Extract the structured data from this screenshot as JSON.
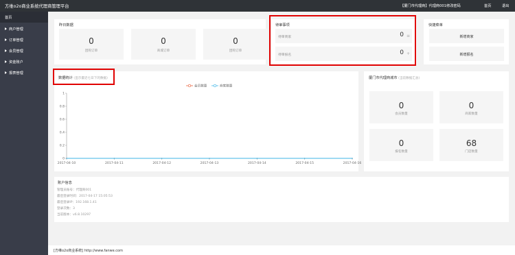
{
  "topbar": {
    "title": "方维o2o商业系统代理商管理平台",
    "user": "【厦门市代理商】代理商001",
    "links": [
      "修改密码",
      "首页",
      "退出"
    ]
  },
  "sidebar": {
    "home": "首页",
    "items": [
      "商户管理",
      "订单管理",
      "会员管理",
      "资金账户",
      "报表管理"
    ]
  },
  "today": {
    "title": "昨日数据",
    "stats": [
      {
        "value": "0",
        "label": "团购订单"
      },
      {
        "value": "0",
        "label": "商城订单"
      },
      {
        "value": "0",
        "label": "团购订单"
      }
    ]
  },
  "todo": {
    "title": "待审事项",
    "rows": [
      {
        "label": "待审商家",
        "value": "0",
        "icon": "≡"
      },
      {
        "label": "待审报名",
        "value": "0",
        "icon": "+"
      }
    ]
  },
  "quick": {
    "title": "快捷菜单",
    "buttons": [
      "新增商家",
      "新增报名"
    ]
  },
  "stats_panel": {
    "title": "数据统计",
    "subtitle": "(显示最近七日下的数据)"
  },
  "chart_data": {
    "type": "line",
    "legend_position": "top-center",
    "x": [
      "2017-04-10",
      "2017-04-11",
      "2017-04-12",
      "2017-04-13",
      "2017-04-14",
      "2017-04-15",
      "2017-04-16"
    ],
    "series": [
      {
        "name": "会员数量",
        "color": "#e8603a",
        "values": [
          0,
          0,
          0,
          0,
          0,
          0,
          0
        ]
      },
      {
        "name": "商家数量",
        "color": "#3db5e6",
        "values": [
          0,
          0,
          0,
          0,
          0,
          0,
          0
        ]
      }
    ],
    "ylim": [
      0,
      1
    ],
    "yticks": [
      "0",
      "0.2",
      "0.4",
      "0.6",
      "0.8",
      "1"
    ],
    "grid": false
  },
  "city": {
    "title": "厦门市代理商城市",
    "subtitle": "(当前数据汇总)",
    "stats": [
      {
        "value": "0",
        "label": "会员数量"
      },
      {
        "value": "0",
        "label": "商家数量"
      },
      {
        "value": "0",
        "label": "报名数量"
      },
      {
        "value": "68",
        "label": "门店数量"
      }
    ]
  },
  "account": {
    "title": "账户信息",
    "lines": [
      "管理员账号：代理商001",
      "最后登录时间：2017-04-17 15:05:53",
      "最后登录IP：192.168.1.41",
      "登录次数：3",
      "当前版本：v6.8.10297"
    ]
  },
  "footer": {
    "text": "[方维o2o商业系统] http://www.fanwe.com"
  }
}
